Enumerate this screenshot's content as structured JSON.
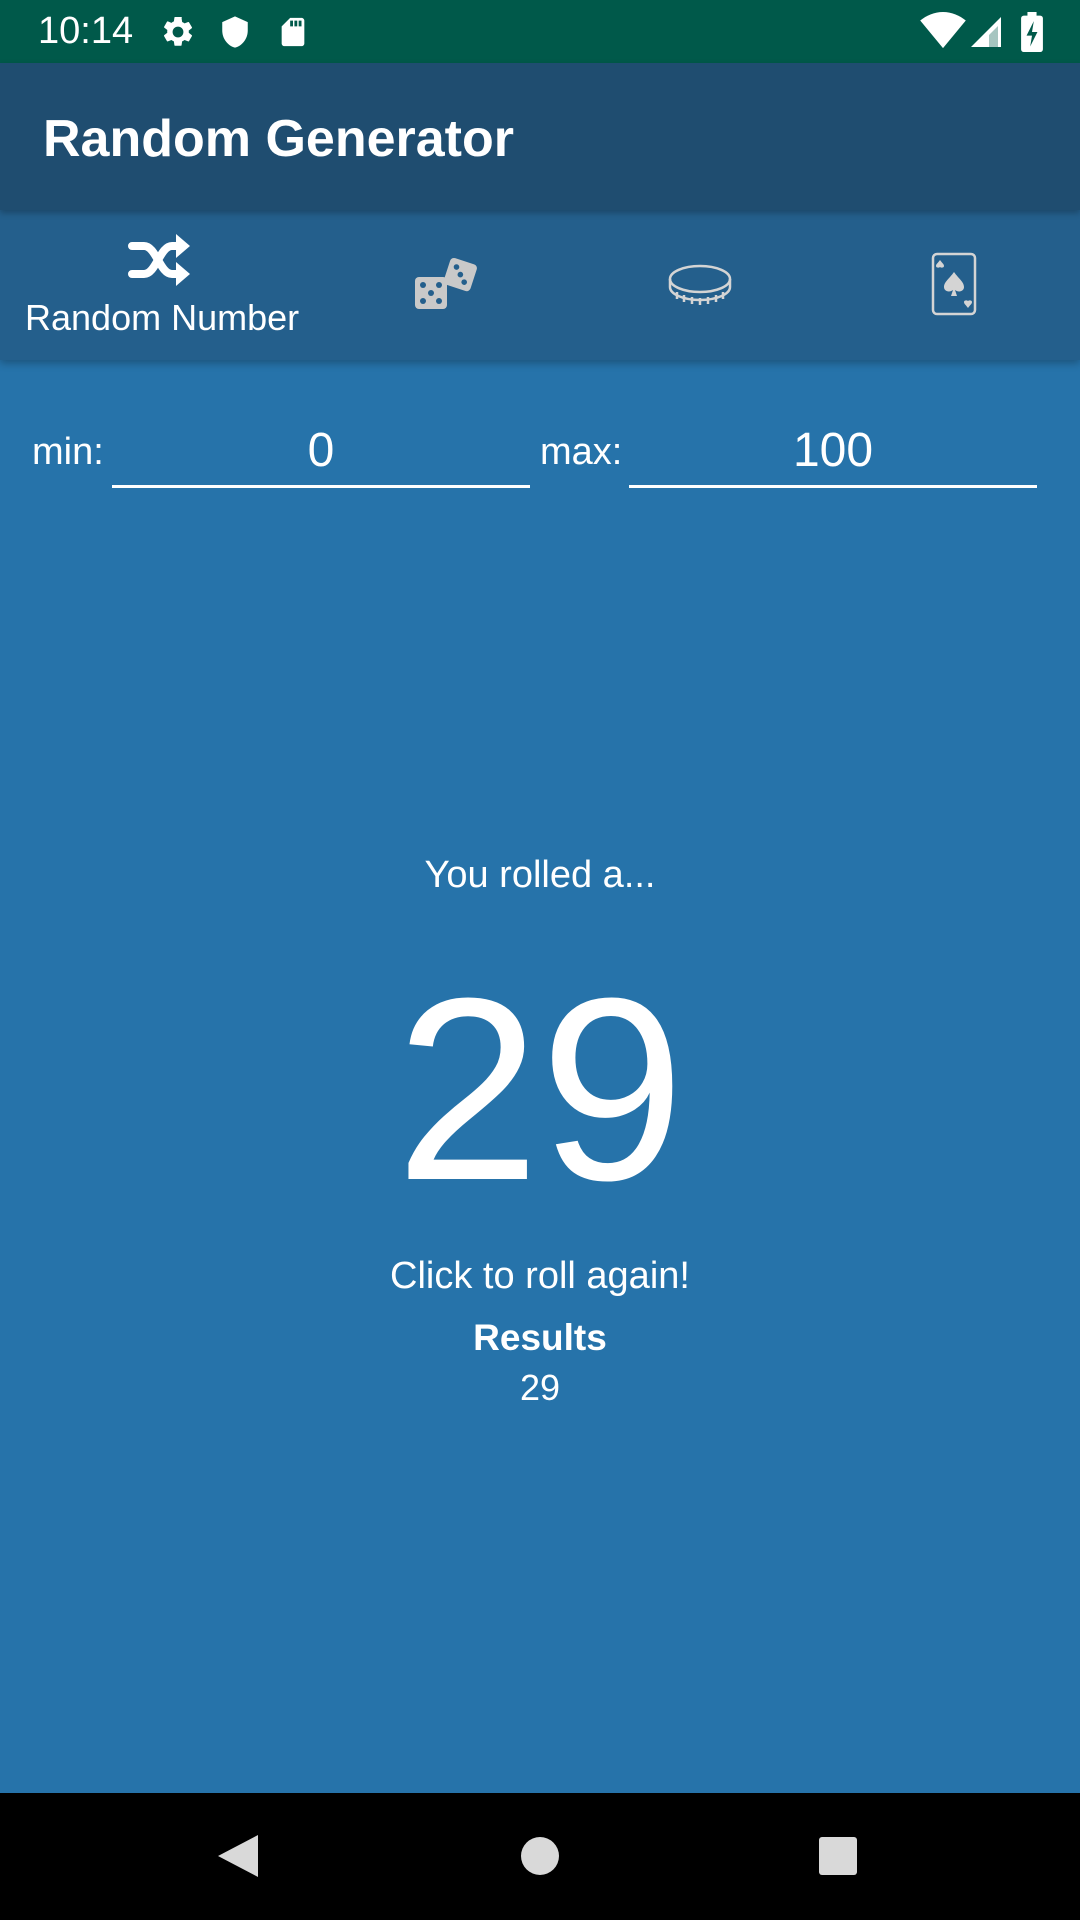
{
  "status_bar": {
    "time": "10:14",
    "left_icons": [
      "gear-icon",
      "shield-icon",
      "sd-card-icon"
    ],
    "right_icons": [
      "wifi-icon",
      "cell-signal-icon",
      "battery-charging-icon"
    ]
  },
  "app_bar": {
    "title": "Random Generator"
  },
  "tabs": [
    {
      "label": "Random Number",
      "icon": "shuffle-icon",
      "selected": true
    },
    {
      "label": "",
      "icon": "dice-icon",
      "selected": false
    },
    {
      "label": "",
      "icon": "coin-icon",
      "selected": false
    },
    {
      "label": "",
      "icon": "playing-card-icon",
      "selected": false
    }
  ],
  "range": {
    "min_label": "min:",
    "min_value": "0",
    "max_label": "max:",
    "max_value": "100"
  },
  "result": {
    "prompt": "You rolled a...",
    "number": "29",
    "roll_again": "Click to roll again!",
    "results_heading": "Results",
    "results_value": "29"
  },
  "nav_bar": {
    "buttons": [
      "back-icon",
      "home-icon",
      "recents-icon"
    ]
  },
  "colors": {
    "status_bar": "#00594a",
    "app_bar": "#1f4d70",
    "tab_bar": "#245f8c",
    "background": "#2673aa",
    "nav_bar": "#000000",
    "text": "#ffffff"
  }
}
